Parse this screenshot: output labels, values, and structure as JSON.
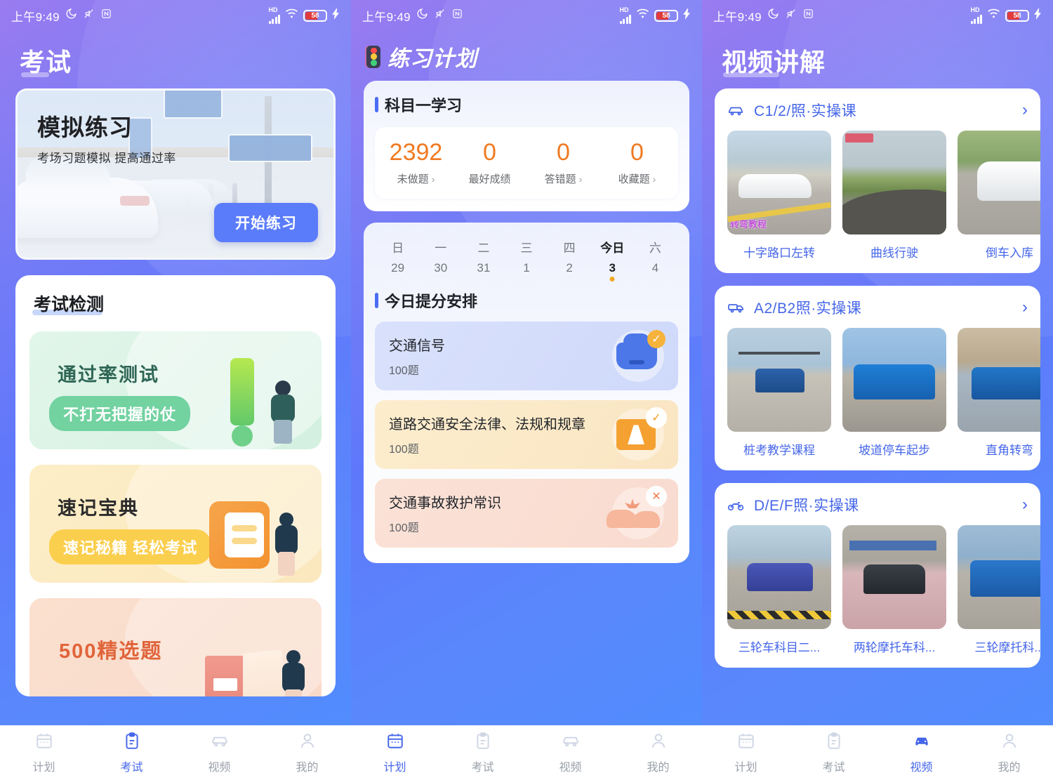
{
  "status_bar": {
    "time": "上午9:49",
    "icons_left": [
      "moon-icon",
      "mute-icon",
      "nfc-icon"
    ],
    "network_label": "HD",
    "battery_level": "58",
    "icons_right": [
      "signal-icon",
      "wifi-icon",
      "battery-icon",
      "charging-icon"
    ]
  },
  "screen1": {
    "title": "考试",
    "banner": {
      "heading": "模拟练习",
      "subheading": "考场习题模拟 提高通过率",
      "button": "开始练习"
    },
    "section_title": "考试检测",
    "promos": [
      {
        "title": "通过率测试",
        "pill": "不打无把握的仗",
        "theme": "green"
      },
      {
        "title": "速记宝典",
        "pill": "速记秘籍 轻松考试",
        "theme": "yellow"
      },
      {
        "title": "500精选题",
        "pill": "",
        "theme": "pink"
      }
    ],
    "tabs": [
      {
        "label": "计划",
        "icon": "calendar-icon",
        "active": false
      },
      {
        "label": "考试",
        "icon": "clipboard-icon",
        "active": true
      },
      {
        "label": "视频",
        "icon": "car-icon",
        "active": false
      },
      {
        "label": "我的",
        "icon": "person-icon",
        "active": false
      }
    ]
  },
  "screen2": {
    "title": "练习计划",
    "title_icon": "traffic-light-icon",
    "subject_card": {
      "heading": "科目一学习",
      "stats": [
        {
          "value": "2392",
          "label": "未做题",
          "has_chevron": true
        },
        {
          "value": "0",
          "label": "最好成绩",
          "has_chevron": false
        },
        {
          "value": "0",
          "label": "答错题",
          "has_chevron": true
        },
        {
          "value": "0",
          "label": "收藏题",
          "has_chevron": true
        }
      ]
    },
    "calendar": [
      {
        "day": "日",
        "date": "29",
        "today": false
      },
      {
        "day": "一",
        "date": "30",
        "today": false
      },
      {
        "day": "二",
        "date": "31",
        "today": false
      },
      {
        "day": "三",
        "date": "1",
        "today": false
      },
      {
        "day": "四",
        "date": "2",
        "today": false
      },
      {
        "day": "今日",
        "date": "3",
        "today": true
      },
      {
        "day": "六",
        "date": "4",
        "today": false
      }
    ],
    "schedule_heading": "今日提分安排",
    "tasks": [
      {
        "name": "交通信号",
        "count": "100题",
        "badge": "✓",
        "theme": "blue",
        "icon": "car-icon"
      },
      {
        "name": "道路交通安全法律、法规和规章",
        "count": "100题",
        "badge": "✓",
        "theme": "yellow",
        "icon": "road-board-icon"
      },
      {
        "name": "交通事故救护常识",
        "count": "100题",
        "badge": "✕",
        "theme": "pink",
        "icon": "crash-icon"
      }
    ],
    "tabs": [
      {
        "label": "计划",
        "icon": "calendar-icon",
        "active": true
      },
      {
        "label": "考试",
        "icon": "clipboard-icon",
        "active": false
      },
      {
        "label": "视频",
        "icon": "car-icon",
        "active": false
      },
      {
        "label": "我的",
        "icon": "person-icon",
        "active": false
      }
    ]
  },
  "screen3": {
    "title": "视频讲解",
    "groups": [
      {
        "name": "C1/2/照·实操课",
        "icon": "car-icon",
        "arrow": "›",
        "videos": [
          {
            "label": "十字路口左转",
            "overlay": "转弯教程"
          },
          {
            "label": "曲线行驶",
            "overlay": ""
          },
          {
            "label": "倒车入库",
            "overlay": ""
          }
        ]
      },
      {
        "name": "A2/B2照·实操课",
        "icon": "truck-icon",
        "arrow": "›",
        "videos": [
          {
            "label": "桩考教学课程",
            "overlay": ""
          },
          {
            "label": "坡道停车起步",
            "overlay": ""
          },
          {
            "label": "直角转弯",
            "overlay": ""
          }
        ]
      },
      {
        "name": "D/E/F照·实操课",
        "icon": "motorcycle-icon",
        "arrow": "›",
        "videos": [
          {
            "label": "三轮车科目二...",
            "overlay": ""
          },
          {
            "label": "两轮摩托车科...",
            "overlay": ""
          },
          {
            "label": "三轮摩托科...",
            "overlay": ""
          }
        ]
      }
    ],
    "tabs": [
      {
        "label": "计划",
        "icon": "calendar-icon",
        "active": false
      },
      {
        "label": "考试",
        "icon": "clipboard-icon",
        "active": false
      },
      {
        "label": "视频",
        "icon": "car-icon",
        "active": true
      },
      {
        "label": "我的",
        "icon": "person-icon",
        "active": false
      }
    ]
  },
  "colors": {
    "accent": "#4566e8",
    "stat_number": "#f07a22",
    "bg_gradient_start": "#9a7bf0",
    "bg_gradient_end": "#4f8dfd"
  }
}
